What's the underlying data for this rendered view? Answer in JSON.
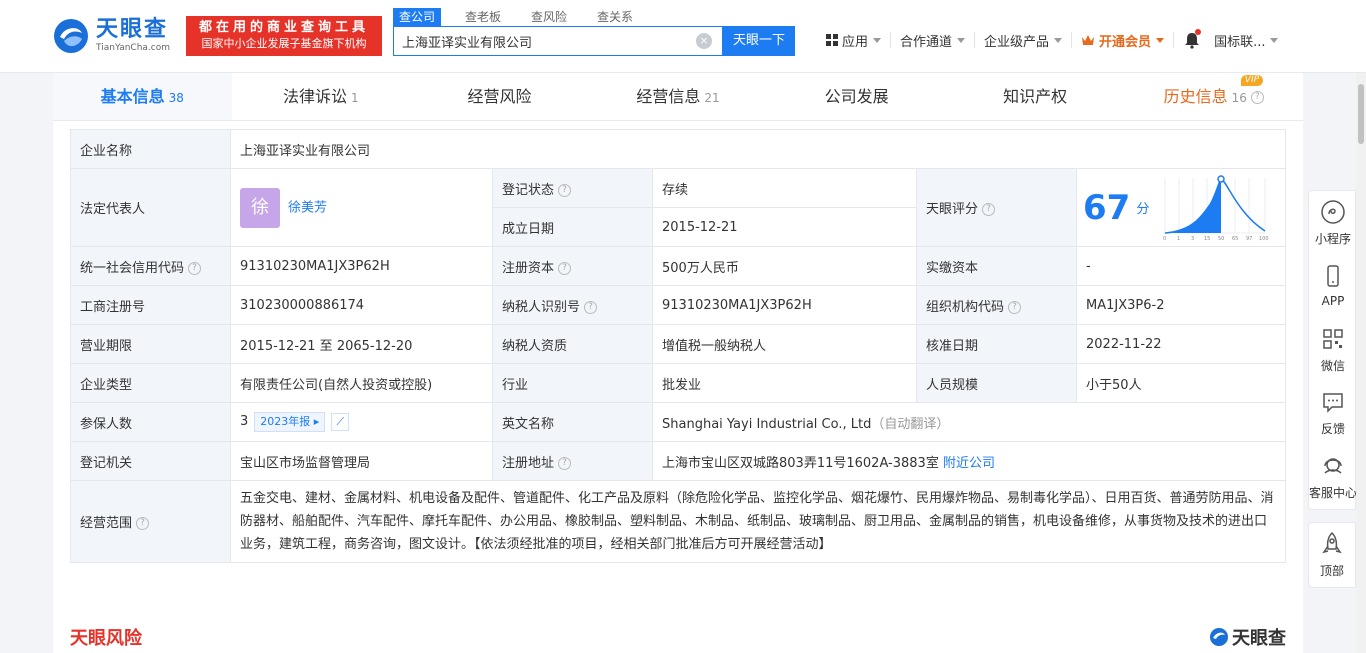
{
  "header": {
    "logo_text": "天眼查",
    "logo_sub": "TianYanCha.com",
    "slogan_line1": "都在用的商业查询工具",
    "slogan_line2": "国家中小企业发展子基金旗下机构",
    "search_tabs": [
      "查公司",
      "查老板",
      "查风险",
      "查关系"
    ],
    "search_value": "上海亚译实业有限公司",
    "search_button": "天眼一下",
    "nav": {
      "apps": "应用",
      "channel": "合作通道",
      "enterprise": "企业级产品",
      "vip": "开通会员",
      "intl": "国标联..."
    }
  },
  "tabs": [
    {
      "label": "基本信息",
      "count": "38"
    },
    {
      "label": "法律诉讼",
      "count": "1"
    },
    {
      "label": "经营风险",
      "count": ""
    },
    {
      "label": "经营信息",
      "count": "21"
    },
    {
      "label": "公司发展",
      "count": ""
    },
    {
      "label": "知识产权",
      "count": ""
    },
    {
      "label": "历史信息",
      "count": "16",
      "tag": "VIP"
    }
  ],
  "info": {
    "company_name_label": "企业名称",
    "company_name": "上海亚译实业有限公司",
    "legal_rep_label": "法定代表人",
    "legal_rep_avatar": "徐",
    "legal_rep": "徐美芳",
    "reg_status_label": "登记状态",
    "reg_status": "存续",
    "found_date_label": "成立日期",
    "found_date": "2015-12-21",
    "score_label": "天眼评分",
    "score": "67",
    "score_unit": "分",
    "score_ticks": [
      "0",
      "1",
      "3",
      "15",
      "50",
      "65",
      "97",
      "100"
    ],
    "credit_code_label": "统一社会信用代码",
    "credit_code": "91310230MA1JX3P62H",
    "reg_capital_label": "注册资本",
    "reg_capital": "500万人民币",
    "paid_capital_label": "实缴资本",
    "paid_capital": "-",
    "reg_no_label": "工商注册号",
    "reg_no": "310230000886174",
    "taxpayer_id_label": "纳税人识别号",
    "taxpayer_id": "91310230MA1JX3P62H",
    "org_code_label": "组织机构代码",
    "org_code": "MA1JX3P6-2",
    "term_label": "营业期限",
    "term": "2015-12-21 至 2065-12-20",
    "taxpayer_qual_label": "纳税人资质",
    "taxpayer_qual": "增值税一般纳税人",
    "approve_date_label": "核准日期",
    "approve_date": "2022-11-22",
    "type_label": "企业类型",
    "type": "有限责任公司(自然人投资或控股)",
    "industry_label": "行业",
    "industry": "批发业",
    "staff_label": "人员规模",
    "staff": "小于50人",
    "insured_label": "参保人数",
    "insured": "3",
    "insured_badge": "2023年报",
    "en_name_label": "英文名称",
    "en_name": "Shanghai Yayi Industrial Co., Ltd",
    "en_name_note": "（自动翻译）",
    "authority_label": "登记机关",
    "authority": "宝山区市场监督管理局",
    "address_label": "注册地址",
    "address": "上海市宝山区双城路803弄11号1602A-3883室",
    "nearby": "附近公司",
    "scope_label": "经营范围",
    "scope": "五金交电、建材、金属材料、机电设备及配件、管道配件、化工产品及原料（除危险化学品、监控化学品、烟花爆竹、民用爆炸物品、易制毒化学品）、日用百货、普通劳防用品、消防器材、船舶配件、汽车配件、摩托车配件、办公用品、橡胶制品、塑料制品、木制品、纸制品、玻璃制品、厨卫用品、金属制品的销售，机电设备维修，从事货物及技术的进出口业务，建筑工程，商务咨询，图文设计。【依法须经批准的项目，经相关部门批准后方可开展经营活动】"
  },
  "risk_title": "天眼风险",
  "risk_logo": "天眼查",
  "sidebar": [
    "小程序",
    "APP",
    "微信",
    "反馈",
    "客服中心"
  ],
  "top_button": "顶部",
  "colors": {
    "brand_blue": "#1d7cf2",
    "alert_red": "#e6332a",
    "vip_orange": "#e56a1e",
    "status_green": "#26a760"
  }
}
